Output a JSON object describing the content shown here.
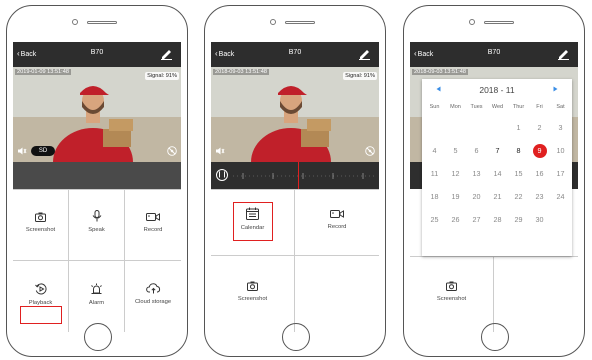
{
  "phones": [
    {
      "nav": {
        "back_label": "Back",
        "title": "B70"
      },
      "video": {
        "timestamp": "2019-01-09  13:51:48",
        "signal": "Signal: 91%",
        "quality": "SD"
      },
      "buttons": [
        {
          "label": "Screenshot",
          "icon": "camera-icon"
        },
        {
          "label": "Speak",
          "icon": "microphone-icon"
        },
        {
          "label": "Record",
          "icon": "video-record-icon"
        },
        {
          "label": "Playback",
          "icon": "playback-icon",
          "highlighted": true
        },
        {
          "label": "Alarm",
          "icon": "alarm-icon"
        },
        {
          "label": "Cloud storage",
          "icon": "cloud-icon"
        }
      ]
    },
    {
      "nav": {
        "back_label": "Back",
        "title": "B70"
      },
      "video": {
        "timestamp": "2018-09-03  13:51:48",
        "signal": "Signal: 91%"
      },
      "buttons": [
        {
          "label": "Calendar",
          "icon": "calendar-icon",
          "highlighted": true
        },
        {
          "label": "Record",
          "icon": "video-record-icon"
        },
        {
          "label": "Screenshot",
          "icon": "camera-icon"
        }
      ]
    },
    {
      "nav": {
        "back_label": "Back",
        "title": "B70"
      },
      "video": {
        "timestamp": "2018-09-03  13:51:48"
      },
      "buttons": [
        {
          "label": "Screenshot",
          "icon": "camera-icon"
        }
      ]
    }
  ],
  "calendar": {
    "month_label": "2018 - 11",
    "weekdays": [
      "Sun",
      "Mon",
      "Tues",
      "Wed",
      "Thur",
      "Fri",
      "Sat"
    ],
    "first_weekday_index": 4,
    "days_in_month": 30,
    "selected_day": 9,
    "days_with_recordings": [
      7,
      8,
      9
    ],
    "selected_color": "#e02020"
  },
  "colors": {
    "accent": "#e02020",
    "nav_bg": "#2d2d2d",
    "ui_bar": "#4a4a4a"
  }
}
